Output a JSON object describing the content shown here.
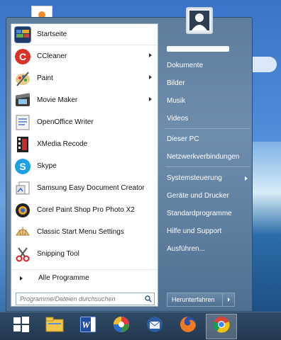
{
  "start_menu": {
    "pinned_programs": [
      {
        "label": "Startseite",
        "icon": "start-screen-icon",
        "submenu": false
      },
      {
        "label": "CCleaner",
        "icon": "ccleaner-icon",
        "submenu": true
      },
      {
        "label": "Paint",
        "icon": "paint-icon",
        "submenu": true
      },
      {
        "label": "Movie Maker",
        "icon": "movie-maker-icon",
        "submenu": true
      },
      {
        "label": "OpenOffice Writer",
        "icon": "openoffice-writer-icon",
        "submenu": false
      },
      {
        "label": "XMedia Recode",
        "icon": "xmedia-recode-icon",
        "submenu": false
      },
      {
        "label": "Skype",
        "icon": "skype-icon",
        "submenu": false
      },
      {
        "label": "Samsung Easy Document Creator",
        "icon": "samsung-document-icon",
        "submenu": false
      },
      {
        "label": "Corel Paint Shop Pro Photo X2",
        "icon": "corel-psp-icon",
        "submenu": false
      },
      {
        "label": "Classic Start Menu Settings",
        "icon": "classic-shell-icon",
        "submenu": false
      },
      {
        "label": "Snipping Tool",
        "icon": "scissors-icon",
        "submenu": false
      }
    ],
    "all_programs_label": "Alle Programme",
    "search_placeholder": "Programme/Dateien durchsuchen",
    "right_links": {
      "dokumente": "Dokumente",
      "bilder": "Bilder",
      "musik": "Musik",
      "videos": "Videos",
      "dieser_pc": "Dieser PC",
      "netzwerk": "Netzwerkverbindungen",
      "systemsteuerung": "Systemsteuerung",
      "geraete": "Geräte und Drucker",
      "standardprogramme": "Standardprogramme",
      "hilfe": "Hilfe und Support",
      "ausfuehren": "Ausführen..."
    },
    "shutdown_label": "Herunterfahren"
  },
  "taskbar": {
    "items": [
      {
        "icon": "windows-start-icon",
        "active": false
      },
      {
        "icon": "file-explorer-icon",
        "active": false
      },
      {
        "icon": "word-icon",
        "active": false
      },
      {
        "icon": "picasa-icon",
        "active": false
      },
      {
        "icon": "thunderbird-icon",
        "active": false
      },
      {
        "icon": "firefox-icon",
        "active": false
      },
      {
        "icon": "chrome-icon",
        "active": true
      }
    ]
  },
  "colors": {
    "menu_bg": "#5e7d9d",
    "taskbar_bg": "#22384f",
    "wallpaper": "#3a74c8"
  }
}
